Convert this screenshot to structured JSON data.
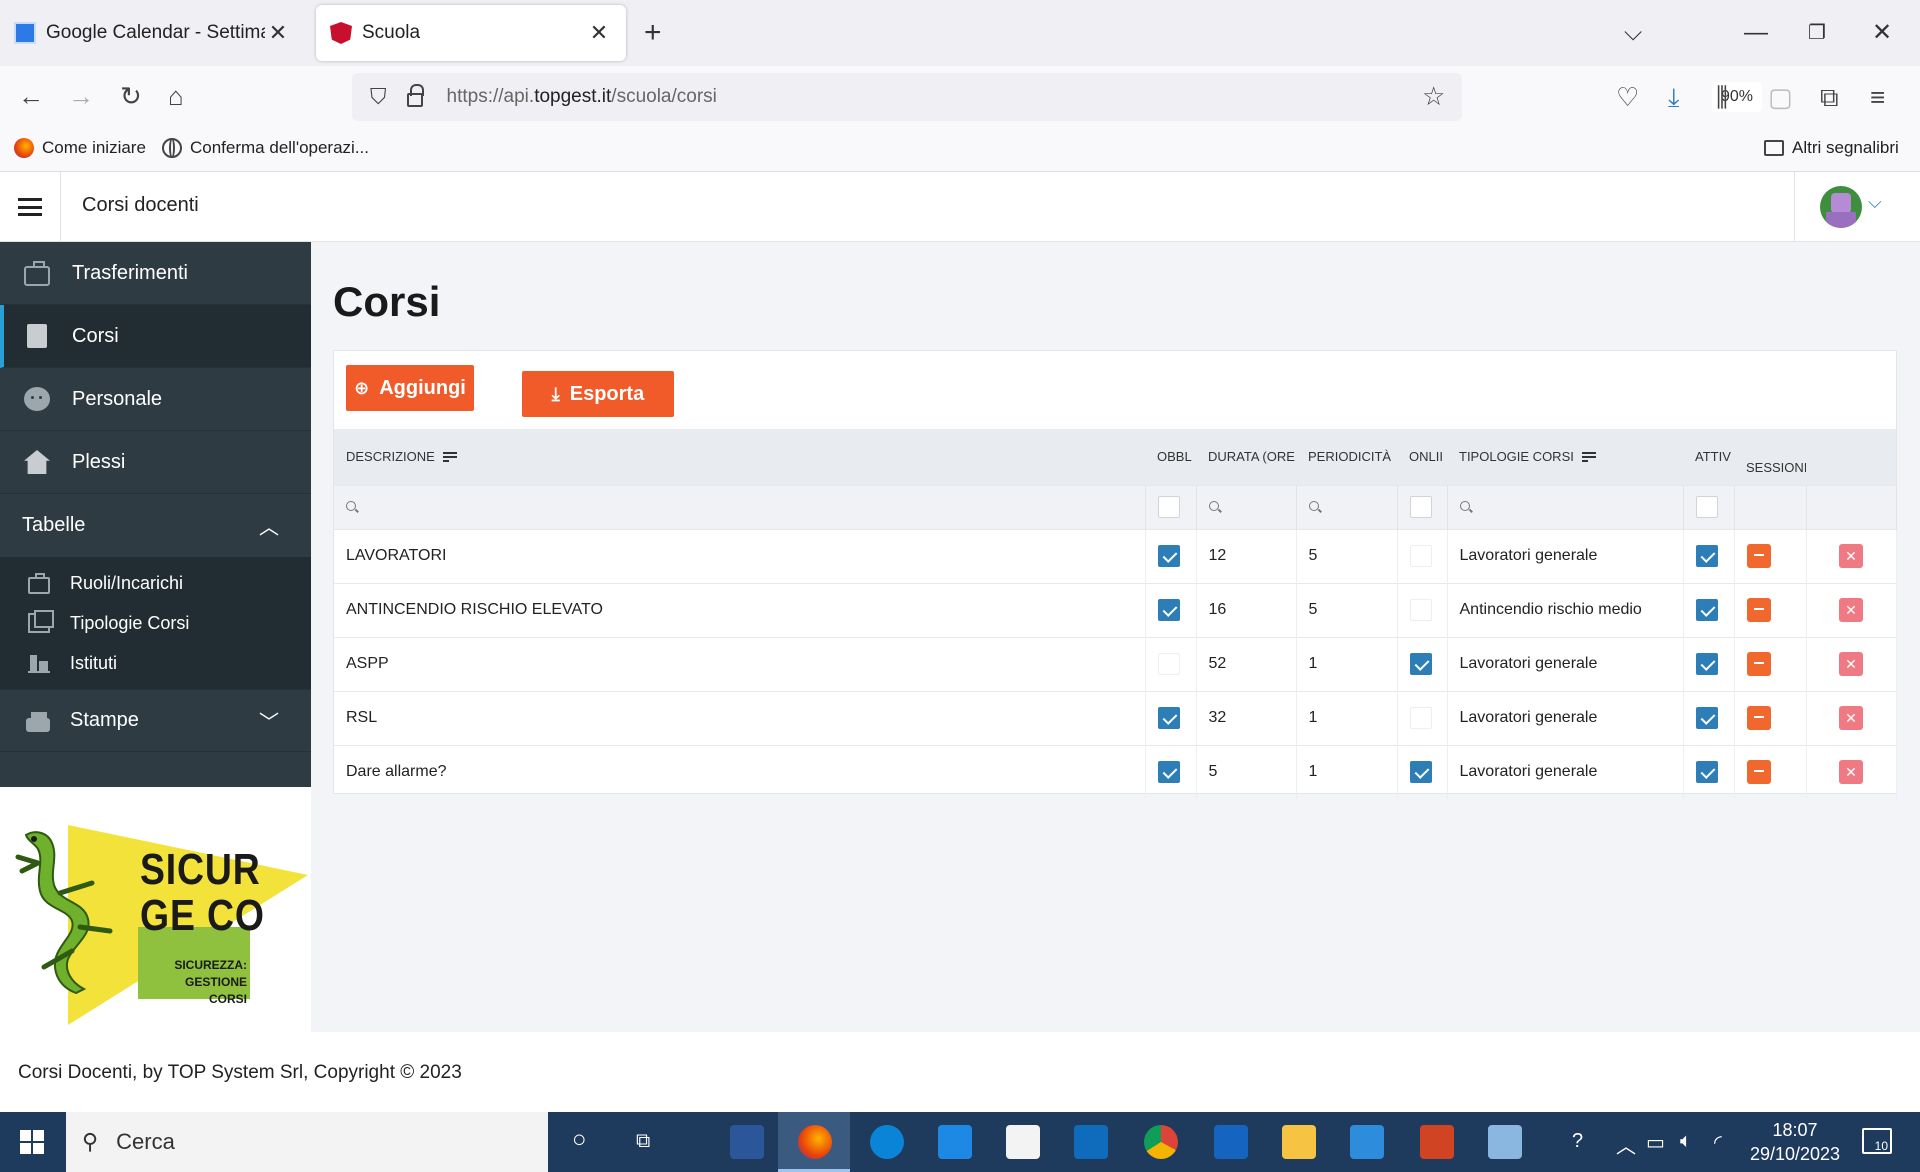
{
  "browser": {
    "tabs": [
      {
        "title": "Google Calendar - Settimana di",
        "active": false,
        "icon": "google-calendar-icon"
      },
      {
        "title": "Scuola",
        "active": true,
        "icon": "angular-icon"
      }
    ],
    "url_prefix": "https://api.",
    "url_domain": "topgest.it",
    "url_path": "/scuola/corsi",
    "zoom": "90%",
    "bookmarks": [
      "Come iniziare",
      "Conferma dell'operazi..."
    ],
    "other_bookmarks": "Altri segnalibri"
  },
  "app": {
    "title": "Corsi docenti",
    "sidebar": {
      "items": [
        {
          "label": "Trasferimenti",
          "icon": "briefcase-icon"
        },
        {
          "label": "Corsi",
          "icon": "book-icon"
        },
        {
          "label": "Personale",
          "icon": "face-icon"
        },
        {
          "label": "Plessi",
          "icon": "home-icon"
        }
      ],
      "group_tabelle": "Tabelle",
      "sub_items": [
        {
          "label": "Ruoli/Incarichi",
          "icon": "briefcase-icon"
        },
        {
          "label": "Tipologie Corsi",
          "icon": "layers-icon"
        },
        {
          "label": "Istituti",
          "icon": "building-icon"
        }
      ],
      "group_stampe": "Stampe"
    },
    "logo": {
      "line1": "SICUR",
      "line2": "GE CO",
      "sub1": "SICUREZZA:",
      "sub2": "GESTIONE",
      "sub3": "CORSI"
    },
    "page_title": "Corsi",
    "buttons": {
      "add": "Aggiungi",
      "export": "Esporta"
    },
    "table": {
      "headers": {
        "descrizione": "DESCRIZIONE",
        "obbl": "OBBL",
        "durata": "DURATA (ORE",
        "periodicita": "PERIODICITÀ",
        "online": "ONLII",
        "tipologie": "TIPOLOGIE CORSI",
        "attivo": "ATTIV",
        "sessioni": "SESSIONI"
      },
      "rows": [
        {
          "descrizione": "LAVORATORI",
          "obbl": true,
          "durata": "12",
          "periodicita": "5",
          "online": false,
          "tipologia": "Lavoratori generale",
          "attivo": true
        },
        {
          "descrizione": "ANTINCENDIO RISCHIO ELEVATO",
          "obbl": true,
          "durata": "16",
          "periodicita": "5",
          "online": false,
          "tipologia": "Antincendio rischio medio",
          "attivo": true
        },
        {
          "descrizione": "ASPP",
          "obbl": false,
          "durata": "52",
          "periodicita": "1",
          "online": true,
          "tipologia": "Lavoratori generale",
          "attivo": true
        },
        {
          "descrizione": "RSL",
          "obbl": true,
          "durata": "32",
          "periodicita": "1",
          "online": false,
          "tipologia": "Lavoratori generale",
          "attivo": true
        },
        {
          "descrizione": "Dare allarme?",
          "obbl": true,
          "durata": "5",
          "periodicita": "1",
          "online": true,
          "tipologia": "Lavoratori generale",
          "attivo": true
        }
      ]
    },
    "footer": "Corsi Docenti, by TOP System Srl, Copyright © 2023"
  },
  "taskbar": {
    "search_placeholder": "Cerca",
    "time": "18:07",
    "date": "29/10/2023",
    "notifications": "10"
  },
  "colors": {
    "accent": "#f15a29",
    "sidebar_bg": "#2f3b43",
    "checkbox_on": "#2d7eb6",
    "taskbar_bg": "#1e3a5c"
  }
}
